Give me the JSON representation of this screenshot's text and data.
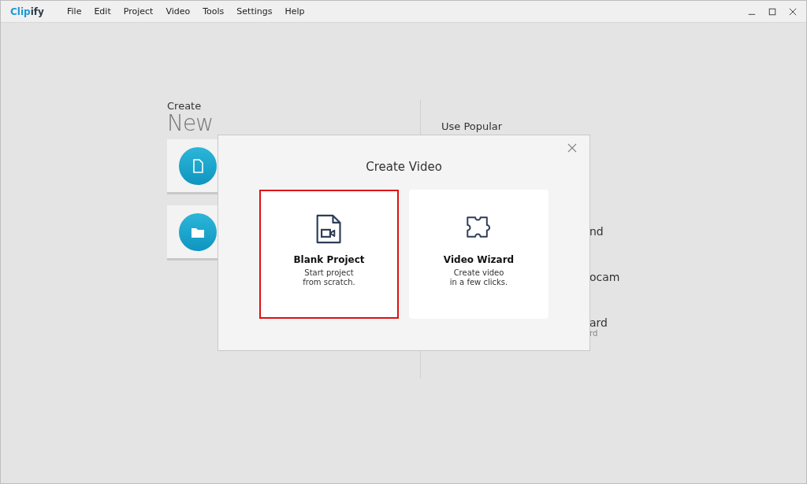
{
  "app": {
    "logo": [
      {
        "text": "Clip",
        "color": "#1a9ad6"
      },
      {
        "text": "ify",
        "color": "#2b3a4a"
      }
    ]
  },
  "menu": [
    "File",
    "Edit",
    "Project",
    "Video",
    "Tools",
    "Settings",
    "Help"
  ],
  "home": {
    "heading": "Create",
    "title": "New",
    "cards": [
      {
        "kind": "file"
      },
      {
        "kind": "folder"
      }
    ],
    "popular": {
      "heading": "Use Popular",
      "items": [
        {
          "title": "nd"
        },
        {
          "title": "ocam"
        },
        {
          "title": "ard",
          "subtitle": "rd"
        }
      ]
    }
  },
  "dialog": {
    "title": "Create Video",
    "options": [
      {
        "kind": "blank",
        "title": "Blank Project",
        "description": "Start project\nfrom scratch.",
        "selected": true
      },
      {
        "kind": "wizard",
        "title": "Video Wizard",
        "description": "Create video\nin a few clicks.",
        "selected": false
      }
    ]
  }
}
